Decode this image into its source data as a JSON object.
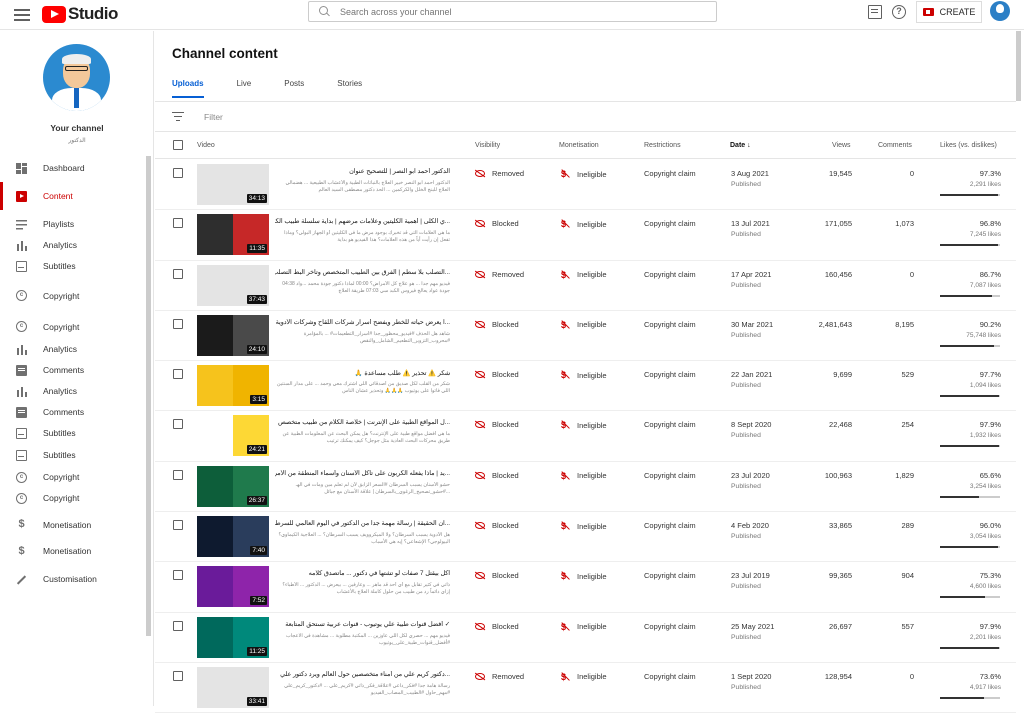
{
  "header": {
    "logo_text": "Studio",
    "search_placeholder": "Search across your channel",
    "create_label": "CREATE",
    "help_label": "?"
  },
  "sidebar": {
    "channel_title": "Your channel",
    "channel_name": "الدكتور",
    "items": [
      {
        "label": "Dashboard",
        "icon": "dashboard-icon",
        "active": false
      },
      {
        "label": "Content",
        "icon": "content-icon",
        "active": true
      },
      {
        "label": "Playlists",
        "icon": "playlists-icon",
        "active": false
      },
      {
        "label": "Analytics",
        "icon": "analytics-icon",
        "active": false
      },
      {
        "label": "Subtitles",
        "icon": "subtitles-icon",
        "active": false
      },
      {
        "label": "Copyright",
        "icon": "copyright-icon",
        "active": false
      },
      {
        "label": "Copyright",
        "icon": "copyright-icon",
        "active": false
      },
      {
        "label": "Analytics",
        "icon": "analytics-icon",
        "active": false
      },
      {
        "label": "Comments",
        "icon": "comments-icon",
        "active": false
      },
      {
        "label": "Analytics",
        "icon": "analytics-icon",
        "active": false
      },
      {
        "label": "Comments",
        "icon": "comments-icon",
        "active": false
      },
      {
        "label": "Subtitles",
        "icon": "subtitles-icon",
        "active": false
      },
      {
        "label": "Subtitles",
        "icon": "subtitles-icon",
        "active": false
      },
      {
        "label": "Copyright",
        "icon": "copyright-icon",
        "active": false
      },
      {
        "label": "Copyright",
        "icon": "copyright-icon",
        "active": false
      },
      {
        "label": "Monetisation",
        "icon": "monetisation-icon",
        "active": false
      },
      {
        "label": "Monetisation",
        "icon": "monetisation-icon",
        "active": false
      },
      {
        "label": "Customisation",
        "icon": "customisation-icon",
        "active": false
      }
    ]
  },
  "main": {
    "title": "Channel content",
    "tabs": [
      "Uploads",
      "Live",
      "Posts",
      "Stories"
    ],
    "filter_placeholder": "Filter",
    "columns": {
      "video": "Video",
      "visibility": "Visibility",
      "monetisation": "Monetisation",
      "restrictions": "Restrictions",
      "date": "Date",
      "views": "Views",
      "comments": "Comments",
      "likes": "Likes (vs. dislikes)"
    },
    "rows": [
      {
        "title": "الدكتور أحمد ابو النصر | للتصحيح عنوان",
        "desc": "الدكتور احمد ابو النصر خبير العلاج بالنباتات الطبية والأعشاب الطبيعية ... هضمالي العلاج للبنج الخلل والكركمين ... الحذ دكتور مصطفى السيد العالم",
        "duration": "34:13",
        "thumb": [
          "#e4e4e4",
          "#e4e4e4"
        ],
        "visibility": "Removed",
        "monetisation": "Ineligible",
        "restriction": "Copyright claim",
        "date": "3 Aug 2021",
        "status": "Published",
        "views": "19,545",
        "comments": "0",
        "likes_pct": "97.3%",
        "likes_count": "2,291 likes",
        "ratio": 0.973
      },
      {
        "title": "...ي الكلى | أهمية الكليتين وعلامات مرضهم | بداية سلسلة طبيب الكلى",
        "desc": "ما هي العلامات التي قد تخبرك بوجود مرض ما في الكليتين أو الجهاز البولي؟ وماذا تفعل إن رأيت أياً من هذه العلامات؟ هذا الفيديو هو بداية",
        "duration": "11:35",
        "thumb": [
          "#2e2e2e",
          "#c62828"
        ],
        "visibility": "Blocked",
        "monetisation": "Ineligible",
        "restriction": "Copyright claim",
        "date": "13 Jul 2021",
        "status": "Published",
        "views": "171,055",
        "comments": "1,073",
        "likes_pct": "96.8%",
        "likes_count": "7,245 likes",
        "ratio": 0.968
      },
      {
        "title": "...التصلب بلا سطم | الفرق بين الطبيب المتخصص وتأخر البط التصلب",
        "desc": "فيديو مهم جدا ... هو علاج كل الأمراض؟ 00:00 لماذا دكتور جودة محمد ...واد 04:38 جودة عواد يعالج فيروس الكبد سي 07:03 طريقة العلاج",
        "duration": "37:43",
        "thumb": [
          "#e4e4e4",
          "#e4e4e4"
        ],
        "visibility": "Removed",
        "monetisation": "Ineligible",
        "restriction": "Copyright claim",
        "date": "17 Apr 2021",
        "status": "Published",
        "views": "160,456",
        "comments": "0",
        "likes_pct": "86.7%",
        "likes_count": "7,087 likes",
        "ratio": 0.867
      },
      {
        "title": "...ا يعرض حياته للخطر ويفضح أسرار شركات اللقاح وشركات الأدوية",
        "desc": "شاهد هل الحذف #فيديو_محظور_جداً #أسرار_التطعيمات# ... بالمؤامرة #محروب_التزوير_التطعيم_الشامل_والنقص",
        "duration": "24:10",
        "thumb": [
          "#1b1b1b",
          "#4a4a4a"
        ],
        "visibility": "Blocked",
        "monetisation": "Ineligible",
        "restriction": "Copyright claim",
        "date": "30 Mar 2021",
        "status": "Published",
        "views": "2,481,643",
        "comments": "8,195",
        "likes_pct": "90.2%",
        "likes_count": "75,748 likes",
        "ratio": 0.902
      },
      {
        "title": "شكر ⚠️ تحذير ⚠️ طلب مساعدة 🙏",
        "desc": "شكر من القلب لكل صديق من أصدقائي اللي اشترك معي وحمد ... على مدار السنتين اللي فاتوا على يوتيوب 🙏🙏🙏 وتحذير عشان الناس",
        "duration": "3:15",
        "thumb": [
          "#f6c31c",
          "#f0b400"
        ],
        "visibility": "Blocked",
        "monetisation": "Ineligible",
        "restriction": "Copyright claim",
        "date": "22 Jan 2021",
        "status": "Published",
        "views": "9,699",
        "comments": "529",
        "likes_pct": "97.7%",
        "likes_count": "1,094 likes",
        "ratio": 0.977
      },
      {
        "title": "...ل المواقع الطبية على الإنترنت | خلاصة الكلام من طبيب متخصص",
        "desc": "ما هي أفضل مواقع طبية على الإنترنت؟ هل يمكن البحث عن المعلومات الطبية عن طريق محركات البحث العادية مثل جوجل؟ كيف يمكنك ترتيب",
        "duration": "24:21",
        "thumb": [
          "#ffffff",
          "#fdd835"
        ],
        "visibility": "Blocked",
        "monetisation": "Ineligible",
        "restriction": "Copyright claim",
        "date": "8 Sept 2020",
        "status": "Published",
        "views": "22,468",
        "comments": "254",
        "likes_pct": "97.9%",
        "likes_count": "1,932 likes",
        "ratio": 0.979
      },
      {
        "title": "...يد | ماذا يفعله الكربون على تاكل الأسنان وأسماء المنطقة من الأمراض",
        "desc": "حشو الأسنان يسبب السرطان #السعر الزابق لأن لم تعلم مين ومات في الهـ ...#حشو_تصحيح_الرغوي_بالسرطان | علاقة الأسنان مع جبائل",
        "duration": "26:37",
        "thumb": [
          "#0d5e3a",
          "#1f7a4c"
        ],
        "visibility": "Blocked",
        "monetisation": "Ineligible",
        "restriction": "Copyright claim",
        "date": "23 Jul 2020",
        "status": "Published",
        "views": "100,963",
        "comments": "1,829",
        "likes_pct": "65.6%",
        "likes_count": "3,254 likes",
        "ratio": 0.656
      },
      {
        "title": "...ان الحقيقة | رسالة مهمة جدا من الدكتور في اليوم العالمي للسرطان",
        "desc": "هل الأدوية يسبب السرطان؟ ولا الميكروويف يسبب السرطان؟ ... العلاجية الكيماوي؟ البيولوجي؟ الإشعاعي؟ إيه هي الأسباب",
        "duration": "7:40",
        "thumb": [
          "#0e1a2f",
          "#2a3d5c"
        ],
        "visibility": "Blocked",
        "monetisation": "Ineligible",
        "restriction": "Copyright claim",
        "date": "4 Feb 2020",
        "status": "Published",
        "views": "33,865",
        "comments": "289",
        "likes_pct": "96.0%",
        "likes_count": "3,054 likes",
        "ratio": 0.96
      },
      {
        "title": "اكل بيقتل 7 صفات لو تشتها في دكتور ... ماتصدق كلامه",
        "desc": "ذاتي في كثير تقابل مع أي أحد قد ماهر ... وعارفين ... بيعرض ... الدكتور ... الأطباء؟ إزاي دائماً رد من طبيب من حلول كاملة العلاج بالأعشاب",
        "duration": "7:52",
        "thumb": [
          "#6a1b9a",
          "#8e24aa"
        ],
        "visibility": "Blocked",
        "monetisation": "Ineligible",
        "restriction": "Copyright claim",
        "date": "23 Jul 2019",
        "status": "Published",
        "views": "99,365",
        "comments": "904",
        "likes_pct": "75.3%",
        "likes_count": "4,600 likes",
        "ratio": 0.753
      },
      {
        "title": "✓ أفضل قنوات طبية علي يوتيوب - قنوات عربية تستحق المتابعة",
        "desc": "فيديو مهم ... حصري لكل اللي عاوزين ... المكتبة مطلوبة ... مشاهدة في الاعجاب #أفضل_قنوات_طبية_على_يوتيوب",
        "duration": "11:25",
        "thumb": [
          "#00695c",
          "#00897b"
        ],
        "visibility": "Blocked",
        "monetisation": "Ineligible",
        "restriction": "Copyright claim",
        "date": "25 May 2021",
        "status": "Published",
        "views": "26,697",
        "comments": "557",
        "likes_pct": "97.9%",
        "likes_count": "2,201 likes",
        "ratio": 0.979
      },
      {
        "title": "...دكتور كريم علي من أمناء متخصصين حول العالم ويرد دكتور علي",
        "desc": "رسالة هامة جداً #فكر_داعي #علاقة_فكر_ذاتي #كريم_علي ... #دكتور_كريم_علي #مهم_حاول #الطبيب_المصاب_الفيديو",
        "duration": "33:41",
        "thumb": [
          "#e4e4e4",
          "#e4e4e4"
        ],
        "visibility": "Removed",
        "monetisation": "Ineligible",
        "restriction": "Copyright claim",
        "date": "1 Sept 2020",
        "status": "Published",
        "views": "128,954",
        "comments": "0",
        "likes_pct": "73.6%",
        "likes_count": "4,917 likes",
        "ratio": 0.736
      }
    ]
  }
}
